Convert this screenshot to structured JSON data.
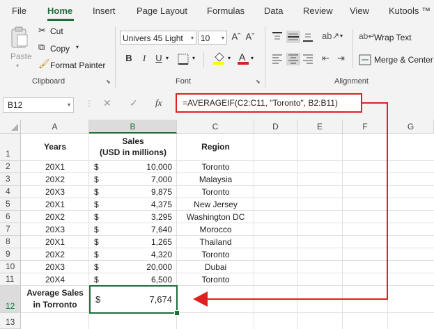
{
  "menu": {
    "tabs": [
      "File",
      "Home",
      "Insert",
      "Page Layout",
      "Formulas",
      "Data",
      "Review",
      "View",
      "Kutools ™"
    ],
    "active": "Home"
  },
  "ribbon": {
    "clipboard": {
      "paste": "Paste",
      "cut": "Cut",
      "copy": "Copy",
      "format_painter": "Format Painter",
      "label": "Clipboard"
    },
    "font": {
      "font_name": "Univers 45 Light",
      "font_size": "10",
      "grow": "Aˆ",
      "shrink": "Aˇ",
      "bold": "B",
      "italic": "I",
      "underline": "U",
      "label": "Font"
    },
    "alignment": {
      "wrap_text": "Wrap Text",
      "merge_center": "Merge & Center",
      "label": "Alignment"
    }
  },
  "formula_bar": {
    "name_box": "B12",
    "fx": "fx",
    "formula": "=AVERAGEIF(C2:C11, \"Toronto\", B2:B11)"
  },
  "sheet": {
    "columns": [
      "A",
      "B",
      "C",
      "D",
      "E",
      "F",
      "G"
    ],
    "rows": [
      "1",
      "2",
      "3",
      "4",
      "5",
      "6",
      "7",
      "8",
      "9",
      "10",
      "11",
      "12",
      "13"
    ],
    "header": {
      "years": "Years",
      "sales_line1": "Sales",
      "sales_line2": "(USD in millions)",
      "region": "Region"
    },
    "data": [
      {
        "year": "20X1",
        "currency": "$",
        "sales": "10,000",
        "region": "Toronto"
      },
      {
        "year": "20X2",
        "currency": "$",
        "sales": "7,000",
        "region": "Malaysia"
      },
      {
        "year": "20X3",
        "currency": "$",
        "sales": "9,875",
        "region": "Toronto"
      },
      {
        "year": "20X1",
        "currency": "$",
        "sales": "4,375",
        "region": "New Jersey"
      },
      {
        "year": "20X2",
        "currency": "$",
        "sales": "3,295",
        "region": "Washington DC"
      },
      {
        "year": "20X3",
        "currency": "$",
        "sales": "7,640",
        "region": "Morocco"
      },
      {
        "year": "20X1",
        "currency": "$",
        "sales": "1,265",
        "region": "Thailand"
      },
      {
        "year": "20X2",
        "currency": "$",
        "sales": "4,320",
        "region": "Toronto"
      },
      {
        "year": "20X3",
        "currency": "$",
        "sales": "20,000",
        "region": "Dubai"
      },
      {
        "year": "20X4",
        "currency": "$",
        "sales": "6,500",
        "region": "Toronto"
      }
    ],
    "result": {
      "label_line1": "Average Sales",
      "label_line2": "in Torronto",
      "currency": "$",
      "value": "7,674"
    }
  },
  "colors": {
    "accent_green": "#1e6e3a",
    "annotation_red": "#e02020"
  }
}
